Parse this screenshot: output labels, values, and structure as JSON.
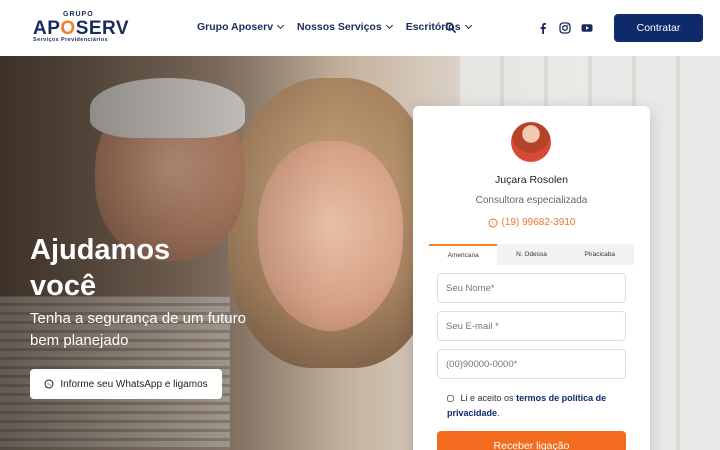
{
  "brand": {
    "grupo": "GRUPO",
    "name_a": "AP",
    "name_o": "O",
    "name_b": "SERV",
    "subtitle": "Serviços Previdenciários"
  },
  "nav": {
    "items": [
      {
        "label": "Grupo Aposerv"
      },
      {
        "label": "Nossos Serviços"
      },
      {
        "label": "Escritórios"
      }
    ],
    "icons": [
      "search-icon",
      "facebook-icon",
      "instagram-icon",
      "youtube-icon"
    ]
  },
  "header": {
    "cta_label": "Contratar"
  },
  "hero": {
    "title": "Ajudamos você",
    "subtitle": "Tenha a segurança de um futuro bem planejado",
    "button_label": "Informe seu WhatsApp e ligamos"
  },
  "card": {
    "agent_name": "Juçara Rosolen",
    "agent_role": "Consultora especializada",
    "agent_phone": "(19) 99682-3910",
    "tabs": [
      {
        "label": "Americana",
        "active": true
      },
      {
        "label": "N. Odessa",
        "active": false
      },
      {
        "label": "Piracicaba",
        "active": false
      }
    ],
    "fields": {
      "name_placeholder": "Seu Nome*",
      "email_placeholder": "Seu E-mail *",
      "phone_placeholder": "(00)90000-0000*"
    },
    "consent_text": "Li e aceito os",
    "consent_link": "termos de política de privacidade",
    "consent_end": ".",
    "submit_label": "Receber ligação"
  },
  "colors": {
    "navy": "#0e2a6b",
    "orange": "#f26b1f",
    "accent_orange": "#f07f2a"
  }
}
